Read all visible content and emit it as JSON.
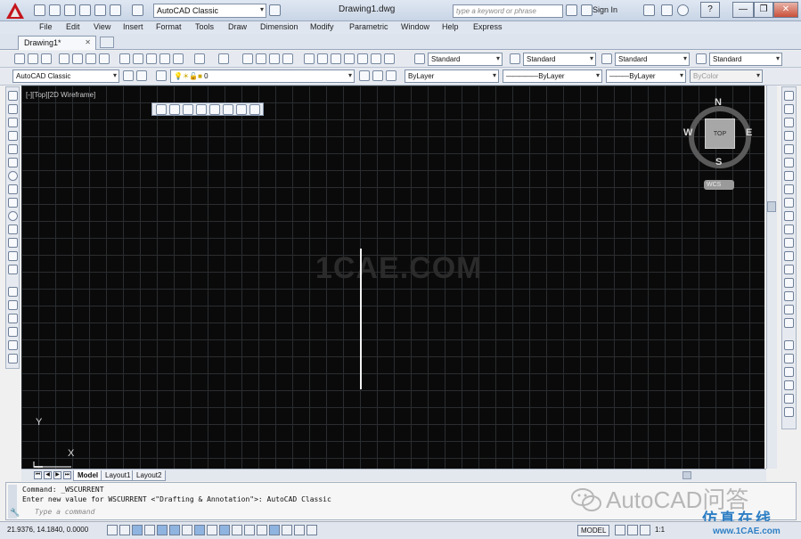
{
  "window": {
    "title": "Drawing1.dwg",
    "workspace": "AutoCAD Classic",
    "search_placeholder": "type a keyword or phrase",
    "sign_in": "Sign In",
    "help": "?",
    "minimize": "—",
    "restore": "❐",
    "close": "✕"
  },
  "menu": [
    "File",
    "Edit",
    "View",
    "Insert",
    "Format",
    "Tools",
    "Draw",
    "Dimension",
    "Modify",
    "Parametric",
    "Window",
    "Help",
    "Express"
  ],
  "tabs": {
    "doc_tab": "Drawing1*",
    "close": "✕"
  },
  "toolbar_styles": {
    "text_style": "Standard",
    "dim_style": "Standard",
    "table_style": "Standard",
    "mleader_style": "Standard"
  },
  "toolbar_props": {
    "workspace": "AutoCAD Classic",
    "layer": "0",
    "color": "ByLayer",
    "linetype": "ByLayer",
    "lineweight": "ByLayer",
    "plotstyle": "ByColor"
  },
  "canvas": {
    "viewport_label": "[-][Top][2D Wireframe]",
    "watermark": "1CAE.COM",
    "viewcube": {
      "top": "TOP",
      "north": "N",
      "south": "S",
      "east": "E",
      "west": "W",
      "wcs": "WCS"
    },
    "ucs_y": "Y",
    "ucs_x": "X"
  },
  "layout_tabs": [
    "Model",
    "Layout1",
    "Layout2"
  ],
  "command": {
    "line1": "Command: _WSCURRENT",
    "line2": "Enter new value for WSCURRENT <\"Drafting & Annotation\">: AutoCAD Classic",
    "input_placeholder": "Type a command"
  },
  "watermarks": {
    "wechat": "AutoCAD问答",
    "cn": "仿真在线",
    "site": "www.1CAE.com"
  },
  "status": {
    "coords": "21.9376, 14.1840, 0.0000",
    "model": "MODEL",
    "scale": "1:1"
  },
  "colors": {
    "canvas_bg": "#0a0a0a",
    "grid": "#2a2d30",
    "drawn_line": "#f2f2f2",
    "app_red": "#c4161c",
    "watermark_blue": "#2e7fc4"
  }
}
